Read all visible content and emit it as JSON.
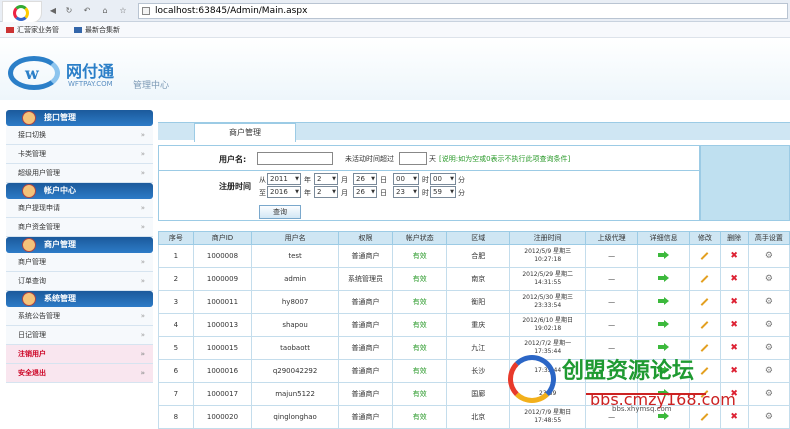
{
  "browser": {
    "url": "localhost:63845/Admin/Main.aspx",
    "favorites": [
      "汇营家业务管",
      "最新合集新"
    ]
  },
  "header": {
    "brand": "网付通",
    "domain": "WFTPAY.COM",
    "subtitle": "管理中心"
  },
  "sidebar": [
    {
      "title": "接口管理",
      "items": [
        "接口切换",
        "卡类管理",
        "超级用户管理"
      ]
    },
    {
      "title": "帐户中心",
      "items": [
        "商户提现申请",
        "商户资金管理"
      ]
    },
    {
      "title": "商户管理",
      "items": [
        "商户管理",
        "订单查询"
      ]
    },
    {
      "title": "系统管理",
      "items": [
        "系统公告管理",
        "日记管理"
      ]
    }
  ],
  "sidebar_footer": [
    "注销用户",
    "安全退出"
  ],
  "tab": {
    "label": "商户管理"
  },
  "form": {
    "username_label": "用户名:",
    "inactive_label": "未活动时间超过",
    "inactive_unit": "天",
    "hint": "[说明:如为空或0表示不执行此项查询条件]",
    "regtime_label": "注册时间",
    "from": "从",
    "to": "至",
    "year": "年",
    "month": "月",
    "day": "日",
    "hour": "时",
    "minute": "分",
    "from_values": {
      "year": "2011",
      "month": "2",
      "day": "26",
      "hour": "00",
      "minute": "00"
    },
    "to_values": {
      "year": "2016",
      "month": "2",
      "day": "26",
      "hour": "23",
      "minute": "59"
    },
    "query_button": "查询"
  },
  "table": {
    "headers": [
      "序号",
      "商户ID",
      "用户名",
      "权限",
      "帐户状态",
      "区域",
      "注册时间",
      "上级代理",
      "详细信息",
      "修改",
      "删除",
      "高手设置"
    ],
    "rows": [
      [
        "1",
        "1000008",
        "test",
        "普通商户",
        "有效",
        "合肥",
        "2012/5/9 星期三 10:27:18",
        "—"
      ],
      [
        "2",
        "1000009",
        "admin",
        "系统管理员",
        "有效",
        "南京",
        "2012/5/29 星期二 14:31:55",
        "—"
      ],
      [
        "3",
        "1000011",
        "hy8007",
        "普通商户",
        "有效",
        "衡阳",
        "2012/5/30 星期三 23:33:54",
        "—"
      ],
      [
        "4",
        "1000013",
        "shapou",
        "普通商户",
        "有效",
        "重庆",
        "2012/6/10 星期日 19:02:18",
        "—"
      ],
      [
        "5",
        "1000015",
        "taobaott",
        "普通商户",
        "有效",
        "九江",
        "2012/7/2 星期一 17:35:44",
        "—"
      ],
      [
        "6",
        "1000016",
        "q290042292",
        "普通商户",
        "有效",
        "长沙",
        "17:35:44",
        "—"
      ],
      [
        "7",
        "1000017",
        "majun5122",
        "普通商户",
        "有效",
        "国廊",
        "23:59",
        "—"
      ],
      [
        "8",
        "1000020",
        "qinglonghao",
        "普通商户",
        "有效",
        "北京",
        "2012/7/9 星期日 17:48:55",
        "—"
      ]
    ]
  },
  "watermark": {
    "title": "创盟资源论坛",
    "url": "bbs.cmzy168.com",
    "sub": "bbs.xhymsq.com"
  }
}
